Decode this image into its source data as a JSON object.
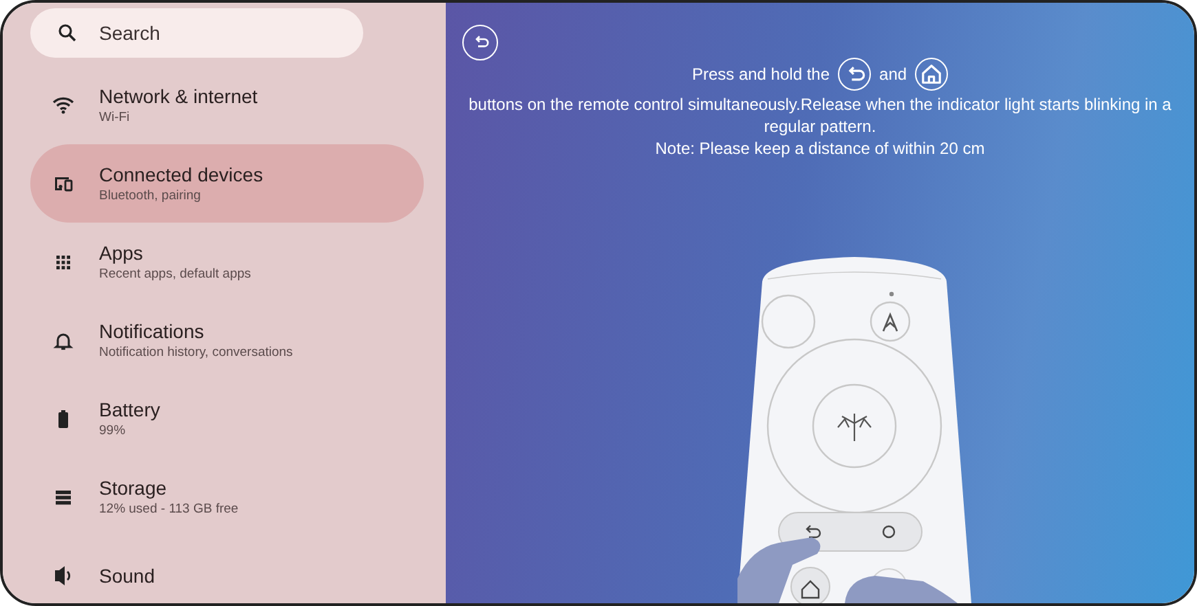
{
  "sidebar": {
    "search": {
      "placeholder": "Search"
    },
    "items": [
      {
        "kind": "wifi",
        "title": "Network & internet",
        "subtitle": "Wi-Fi",
        "selected": false
      },
      {
        "kind": "devices",
        "title": "Connected devices",
        "subtitle": "Bluetooth, pairing",
        "selected": true
      },
      {
        "kind": "apps",
        "title": "Apps",
        "subtitle": "Recent apps, default apps",
        "selected": false
      },
      {
        "kind": "bell",
        "title": "Notifications",
        "subtitle": "Notification history, conversations",
        "selected": false
      },
      {
        "kind": "battery",
        "title": "Battery",
        "subtitle": "99%",
        "selected": false
      },
      {
        "kind": "storage",
        "title": "Storage",
        "subtitle": "12% used - 113 GB free",
        "selected": false
      },
      {
        "kind": "sound",
        "title": "Sound",
        "selected": false
      }
    ]
  },
  "panel": {
    "lead": "Press and hold the",
    "connector": "and",
    "body": "buttons on the remote control simultaneously.Release when the indicator light starts blinking in a regular pattern.",
    "note": "Note: Please keep a distance of within 20 cm"
  }
}
